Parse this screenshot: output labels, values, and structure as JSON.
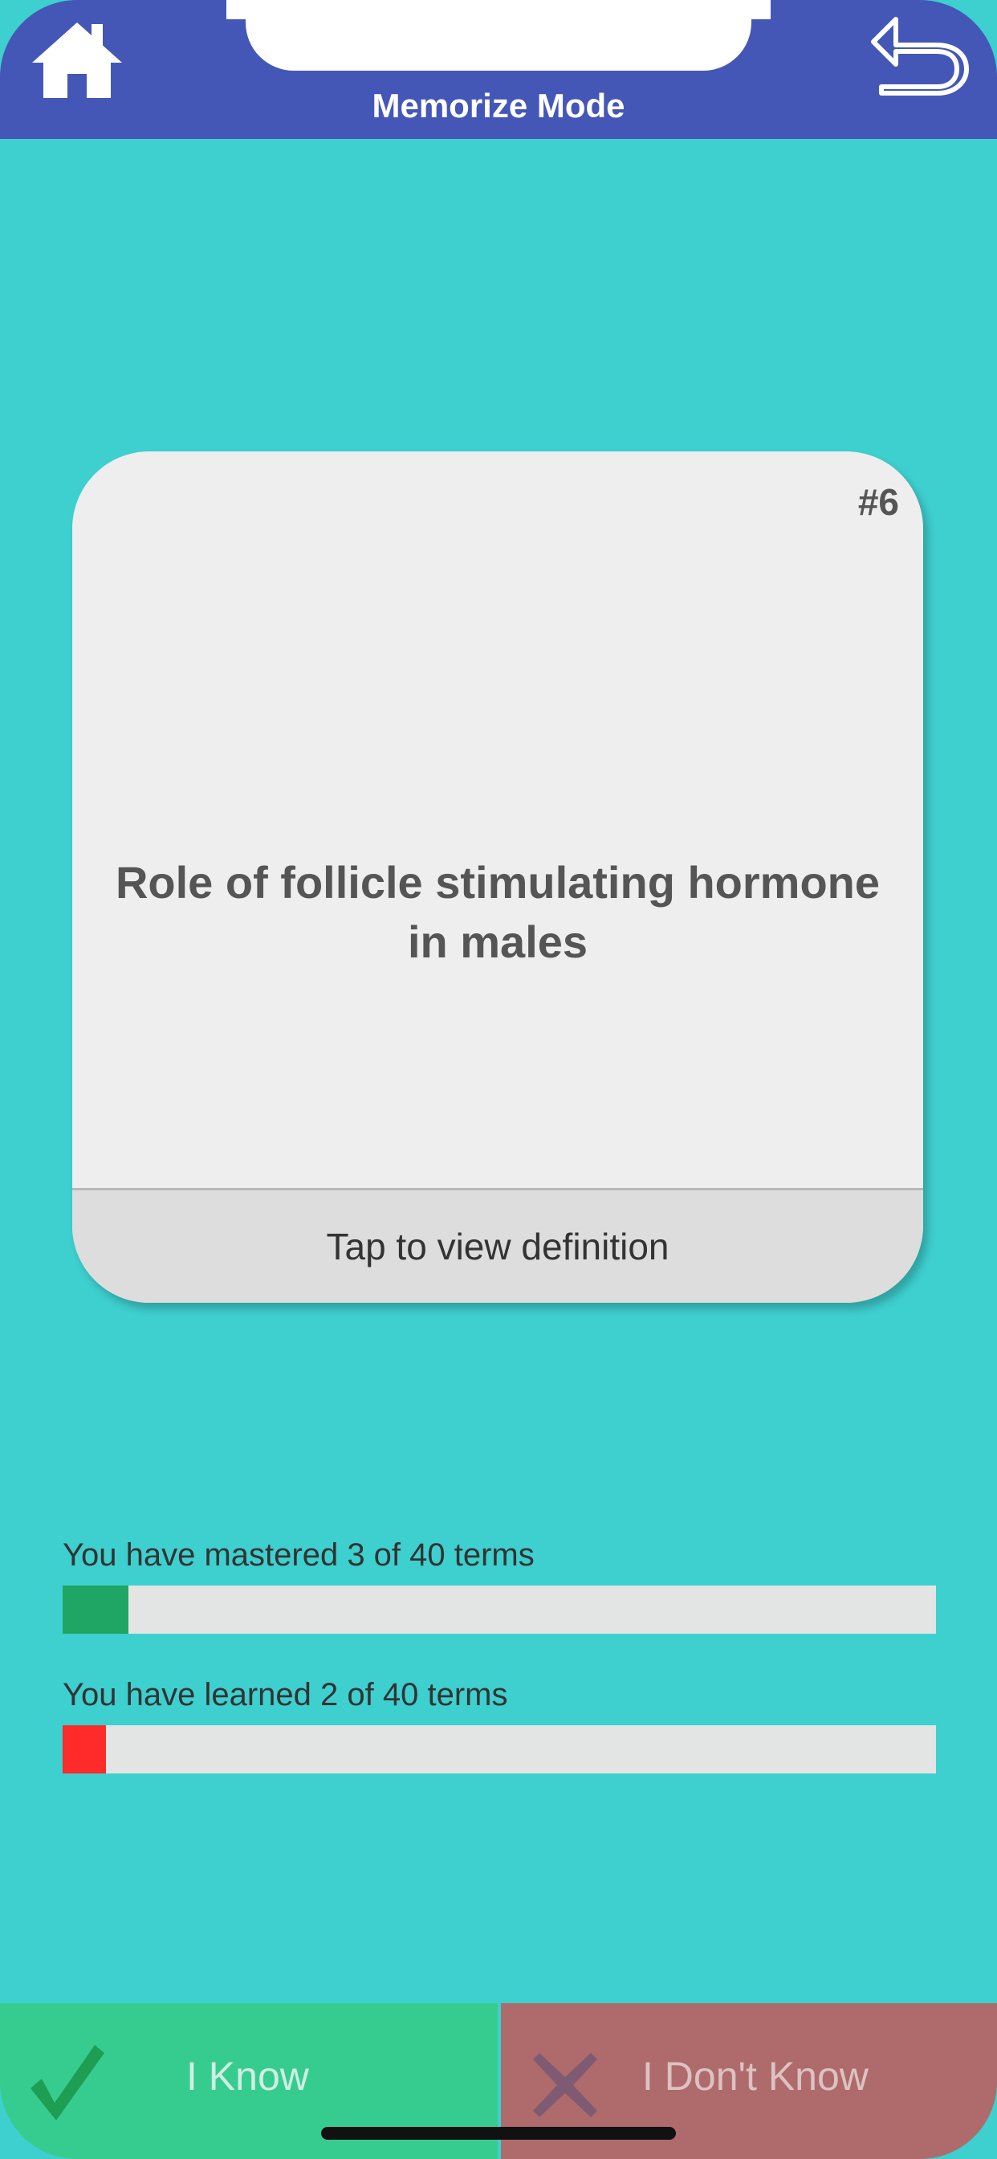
{
  "header": {
    "title": "Memorize Mode"
  },
  "icons": {
    "home": "home-icon",
    "back": "undo-arrow-icon",
    "check": "checkmark-icon",
    "cross": "x-mark-icon"
  },
  "card": {
    "number": "#6",
    "term": "Role of follicle stimulating hormone in males",
    "footer_label": "Tap to view definition"
  },
  "progress": {
    "mastered": {
      "label": "You have mastered 3 of 40 terms",
      "count": 3,
      "total": 40,
      "color": "#1fa564"
    },
    "learned": {
      "label": "You have learned 2 of 40 terms",
      "count": 2,
      "total": 40,
      "color": "#ff2a2a"
    }
  },
  "buttons": {
    "know_label": "I Know",
    "dont_know_label": "I Don't Know"
  },
  "colors": {
    "header_bg": "#4457b7",
    "screen_bg": "#3ecfcf",
    "know_bg": "#37cc8f",
    "dont_know_bg": "#af6b6b"
  }
}
